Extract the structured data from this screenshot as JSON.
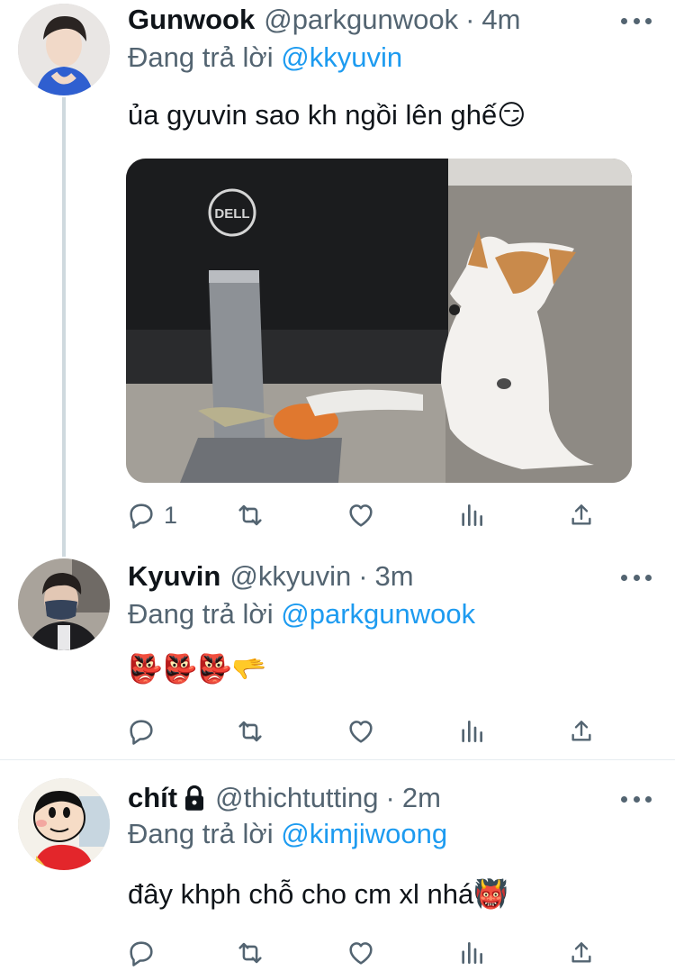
{
  "colors": {
    "accent": "#1d9bf0",
    "text": "#0f1419",
    "secondary": "#536471"
  },
  "tweets": [
    {
      "name": "Gunwook",
      "handle": "@parkgunwook",
      "separator": "·",
      "time": "4m",
      "replying_prefix": "Đang trả lời",
      "replying_to": "@kkyuvin",
      "text": "ủa gyuvin sao kh ngồi lên ghế😏",
      "reply_count": "1",
      "media": {
        "monitor_brand": "DELL",
        "subject": "dog lying behind a monitor"
      }
    },
    {
      "name": "Kyuvin",
      "handle": "@kkyuvin",
      "separator": "·",
      "time": "3m",
      "replying_prefix": "Đang trả lời",
      "replying_to": "@parkgunwook",
      "text": "👺👺👺🫳",
      "reply_count": ""
    },
    {
      "name": "chít",
      "protected_icon": "lock-icon",
      "handle": "@thichtutting",
      "separator": "·",
      "time": "2m",
      "replying_prefix": "Đang trả lời",
      "replying_to": "@kimjiwoong",
      "text": "đây khph chỗ cho cm xl nhá👹",
      "reply_count": ""
    }
  ],
  "action_icons": [
    "reply-icon",
    "retweet-icon",
    "like-icon",
    "analytics-icon",
    "share-icon"
  ]
}
